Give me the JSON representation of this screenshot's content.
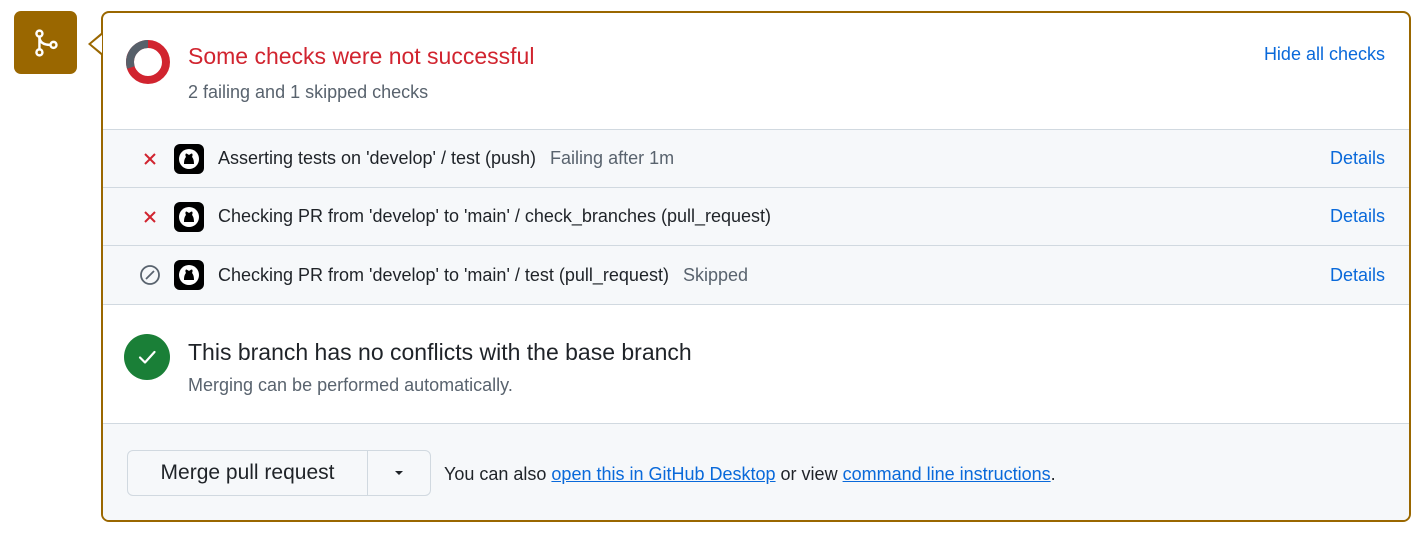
{
  "status": {
    "title": "Some checks were not successful",
    "subtitle": "2 failing and 1 skipped checks",
    "hide_all_label": "Hide all checks"
  },
  "checks": [
    {
      "status": "failing",
      "name": "Asserting tests on 'develop' / test (push)",
      "state": "Failing after 1m",
      "details_label": "Details"
    },
    {
      "status": "failing",
      "name": "Checking PR from 'develop' to 'main' / check_branches (pull_request)",
      "state": "",
      "details_label": "Details"
    },
    {
      "status": "skipped",
      "name": "Checking PR from 'develop' to 'main' / test (pull_request)",
      "state": "Skipped",
      "details_label": "Details"
    }
  ],
  "conflicts": {
    "title": "This branch has no conflicts with the base branch",
    "subtitle": "Merging can be performed automatically."
  },
  "merge": {
    "button_label": "Merge pull request",
    "text_prefix": "You can also ",
    "desktop_link": "open this in GitHub Desktop",
    "text_middle": " or view ",
    "cli_link": "command line instructions",
    "text_suffix": "."
  },
  "colors": {
    "accent_border": "#9a6700",
    "failure": "#d1242f",
    "success": "#1a7f37",
    "link": "#0969da"
  }
}
